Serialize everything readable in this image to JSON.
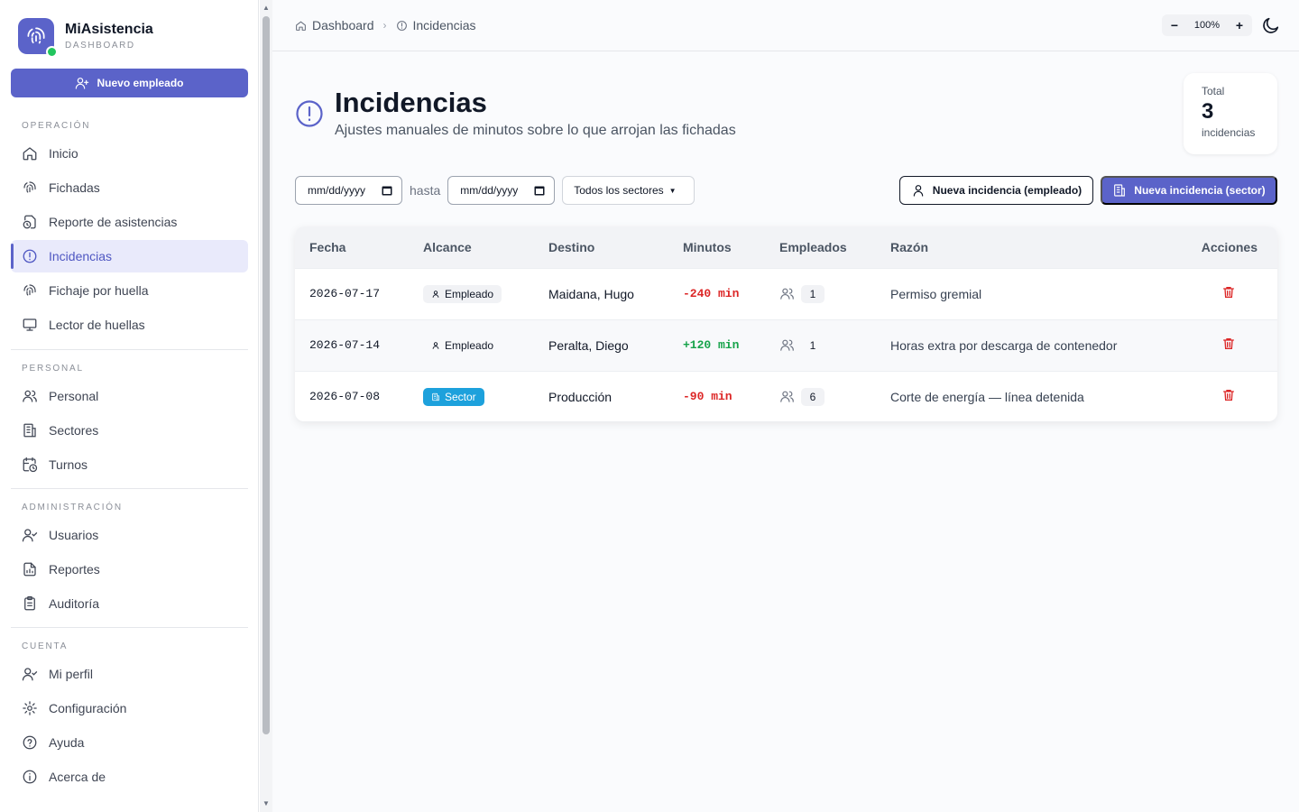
{
  "brand": {
    "name": "MiAsistencia",
    "sub": "DASHBOARD"
  },
  "sidebar": {
    "new_employee_label": "Nuevo empleado",
    "sections": [
      {
        "label": "OPERACIÓN",
        "items": [
          "Inicio",
          "Fichadas",
          "Reporte de asistencias",
          "Incidencias",
          "Fichaje por huella",
          "Lector de huellas"
        ]
      },
      {
        "label": "PERSONAL",
        "items": [
          "Personal",
          "Sectores",
          "Turnos"
        ]
      },
      {
        "label": "ADMINISTRACIÓN",
        "items": [
          "Usuarios",
          "Reportes",
          "Auditoría"
        ]
      },
      {
        "label": "CUENTA",
        "items": [
          "Mi perfil",
          "Configuración",
          "Ayuda",
          "Acerca de"
        ]
      }
    ],
    "active_item": "Incidencias"
  },
  "breadcrumb": {
    "home": "Dashboard",
    "current": "Incidencias"
  },
  "zoom": {
    "value": "100%",
    "minus": "−",
    "plus": "+"
  },
  "header": {
    "title": "Incidencias",
    "subtitle": "Ajustes manuales de minutos sobre lo que arrojan las fichadas"
  },
  "total": {
    "label": "Total",
    "value": "3",
    "unit": "incidencias"
  },
  "filters": {
    "date_from": "mm/dd/yyyy",
    "separator": "hasta",
    "date_to": "mm/dd/yyyy",
    "sector": "Todos los sectores"
  },
  "actions": {
    "new_employee_incident": "Nueva incidencia (empleado)",
    "new_sector_incident": "Nueva incidencia (sector)"
  },
  "table": {
    "columns": [
      "Fecha",
      "Alcance",
      "Destino",
      "Minutos",
      "Empleados",
      "Razón",
      "Acciones"
    ],
    "rows": [
      {
        "fecha": "2026-07-17",
        "alcance": "Empleado",
        "destino": "Maidana, Hugo",
        "minutos": "-240 min",
        "empleados": "1",
        "razon": "Permiso gremial"
      },
      {
        "fecha": "2026-07-14",
        "alcance": "Empleado",
        "destino": "Peralta, Diego",
        "minutos": "+120 min",
        "empleados": "1",
        "razon": "Horas extra por descarga de contenedor"
      },
      {
        "fecha": "2026-07-08",
        "alcance": "Sector",
        "destino": "Producción",
        "minutos": "-90 min",
        "empleados": "6",
        "razon": "Corte de energía — línea detenida"
      }
    ]
  },
  "colors": {
    "accent": "#5b63c9",
    "negative": "#dc2626",
    "positive": "#16a34a",
    "sector_badge": "#1da1dc"
  }
}
